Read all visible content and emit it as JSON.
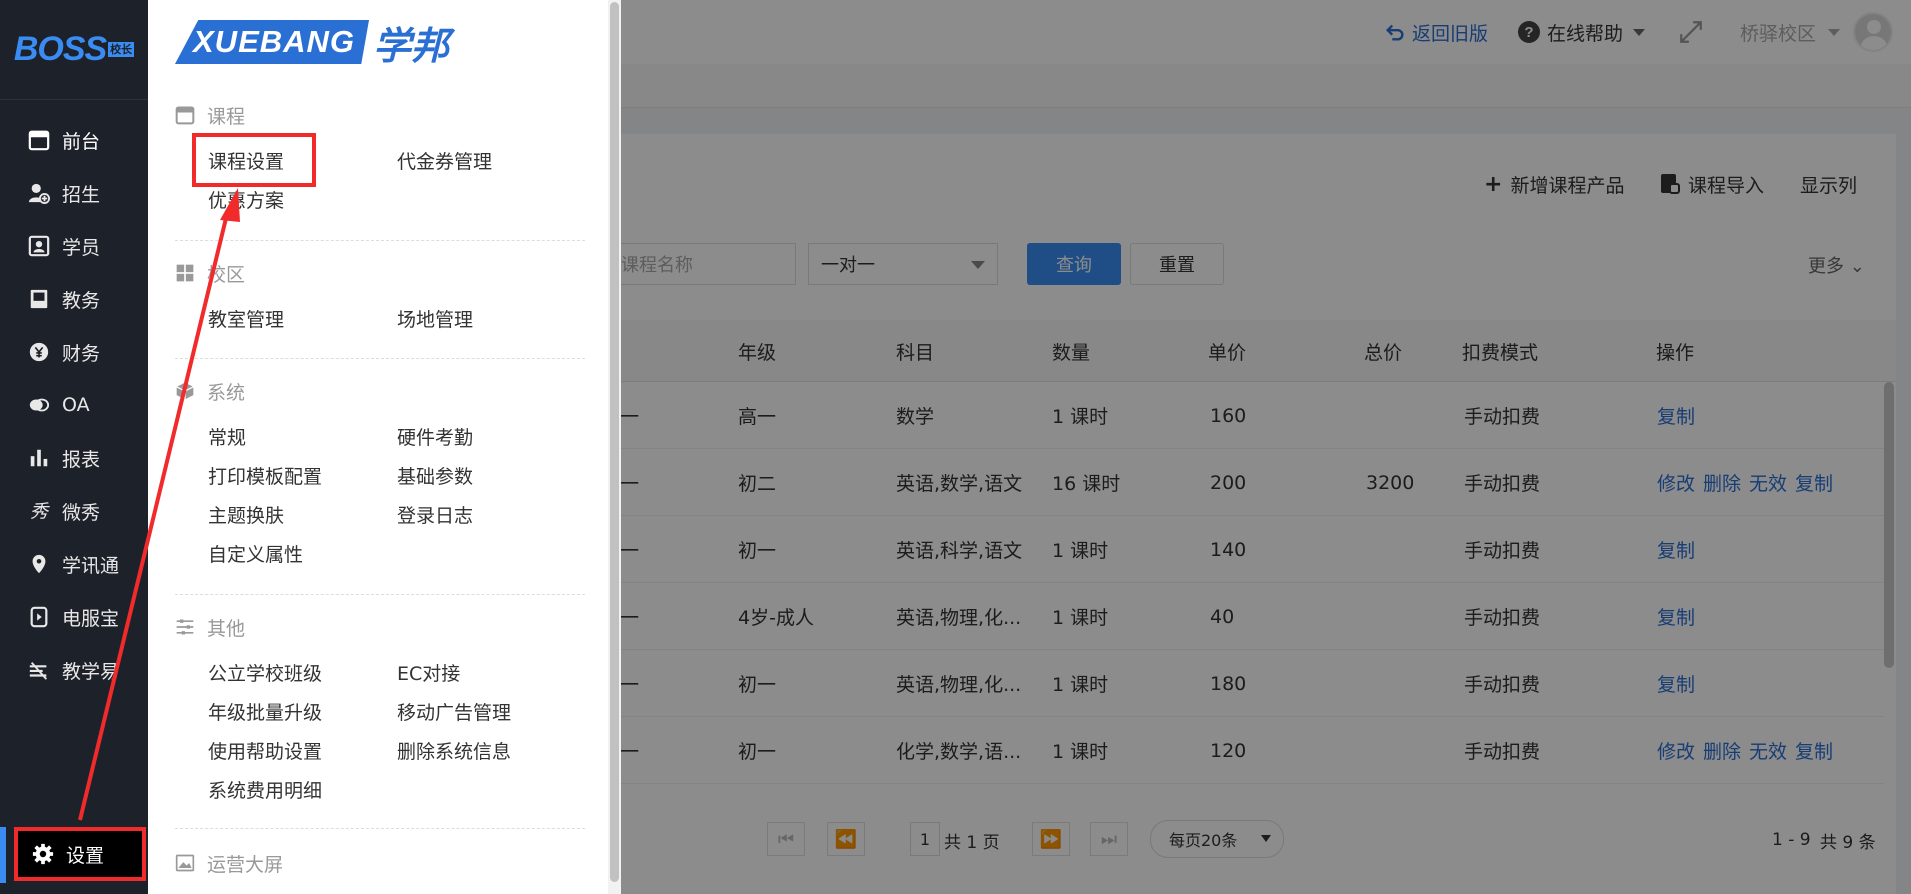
{
  "sidebar": {
    "logo_text": "BOSS",
    "logo_tag": "校长",
    "items": [
      {
        "label": "前台",
        "icon": "calendar-icon"
      },
      {
        "label": "招生",
        "icon": "user-add-icon"
      },
      {
        "label": "学员",
        "icon": "id-card-icon"
      },
      {
        "label": "教务",
        "icon": "book-icon"
      },
      {
        "label": "财务",
        "icon": "yen-icon"
      },
      {
        "label": "OA",
        "icon": "chat-icon"
      },
      {
        "label": "报表",
        "icon": "bar-chart-icon"
      },
      {
        "label": "微秀",
        "icon": "xiu-icon"
      },
      {
        "label": "学讯通",
        "icon": "location-icon"
      },
      {
        "label": "电服宝",
        "icon": "phone-icon"
      },
      {
        "label": "教学易",
        "icon": "teach-icon"
      },
      {
        "label": "设置",
        "icon": "gear-icon"
      }
    ]
  },
  "topbar": {
    "back_label": "返回旧版",
    "help_label": "在线帮助",
    "campus_label": "桥驿校区"
  },
  "toolbar": {
    "add_label": "新增课程产品",
    "import_label": "课程导入",
    "columns_label": "显示列"
  },
  "filters": {
    "name_placeholder": "课程名称",
    "type_value": "一对一",
    "query_label": "查询",
    "reset_label": "重置",
    "more_label": "更多"
  },
  "table": {
    "headers": [
      "年级",
      "科目",
      "数量",
      "单价",
      "总价",
      "扣费模式",
      "操作"
    ],
    "rows": [
      {
        "lead": "一",
        "grade": "高一",
        "subject": "数学",
        "qty": "1 课时",
        "price": "160",
        "total": "",
        "mode": "手动扣费",
        "ops": [
          "复制"
        ]
      },
      {
        "lead": "一",
        "grade": "初二",
        "subject": "英语,数学,语文",
        "qty": "16 课时",
        "price": "200",
        "total": "3200",
        "mode": "手动扣费",
        "ops": [
          "修改",
          "删除",
          "无效",
          "复制"
        ]
      },
      {
        "lead": "一",
        "grade": "初一",
        "subject": "英语,科学,语文",
        "qty": "1 课时",
        "price": "140",
        "total": "",
        "mode": "手动扣费",
        "ops": [
          "复制"
        ]
      },
      {
        "lead": "一",
        "grade": "4岁-成人",
        "subject": "英语,物理,化...",
        "qty": "1 课时",
        "price": "40",
        "total": "",
        "mode": "手动扣费",
        "ops": [
          "复制"
        ]
      },
      {
        "lead": "一",
        "grade": "初一",
        "subject": "英语,物理,化...",
        "qty": "1 课时",
        "price": "180",
        "total": "",
        "mode": "手动扣费",
        "ops": [
          "复制"
        ]
      },
      {
        "lead": "一",
        "grade": "初一",
        "subject": "化学,数学,语...",
        "qty": "1 课时",
        "price": "120",
        "total": "",
        "mode": "手动扣费",
        "ops": [
          "修改",
          "删除",
          "无效",
          "复制"
        ]
      }
    ]
  },
  "pager": {
    "page": "1",
    "total_pages_label": "共 1 页",
    "page_size_label": "每页20条",
    "range_label": "1 - 9",
    "total_label": "共 9 条"
  },
  "panel": {
    "brand_en": "XUEBANG",
    "brand_cn": "学邦",
    "sections": [
      {
        "title": "课程",
        "icon": "calendar-icon",
        "items": [
          "课程设置",
          "代金券管理",
          "优惠方案"
        ]
      },
      {
        "title": "校区",
        "icon": "grid-icon",
        "items": [
          "教室管理",
          "场地管理"
        ]
      },
      {
        "title": "系统",
        "icon": "cube-icon",
        "items": [
          "常规",
          "硬件考勤",
          "打印模板配置",
          "基础参数",
          "主题换肤",
          "登录日志",
          "自定义属性"
        ]
      },
      {
        "title": "其他",
        "icon": "sliders-icon",
        "items": [
          "公立学校班级",
          "EC对接",
          "年级批量升级",
          "移动广告管理",
          "使用帮助设置",
          "删除系统信息",
          "系统费用明细"
        ]
      },
      {
        "title": "运营大屏",
        "icon": "image-icon",
        "items": []
      }
    ]
  },
  "colors": {
    "sidebar_bg": "#1d2129",
    "brand_blue": "#3a8cf3",
    "link_blue": "#2a6fd4",
    "highlight_red": "#f12b2b"
  }
}
